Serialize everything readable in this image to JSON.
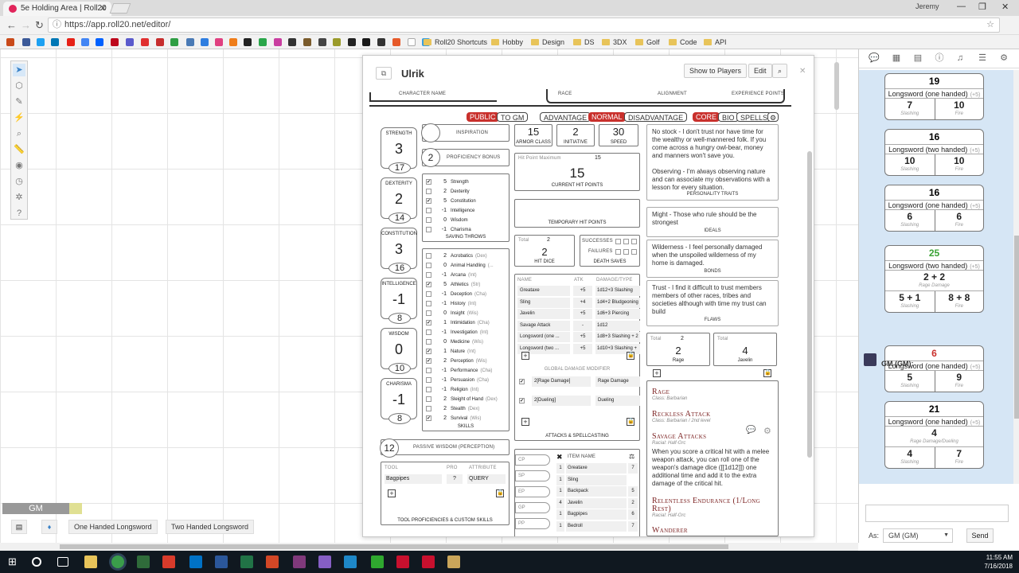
{
  "browser": {
    "tab_title": "5e Holding Area | Roll20",
    "user": "Jeremy",
    "url": "https://app.roll20.net/editor/",
    "bookmark_folders": [
      "Roll20 Shortcuts",
      "Hobby",
      "Design",
      "DS",
      "3DX",
      "Golf",
      "Code",
      "API"
    ]
  },
  "editor": {
    "player_tag": "GM",
    "macros": [
      "One Handed Longsword",
      "Two Handed Longsword"
    ]
  },
  "sheet": {
    "name": "Ulrik",
    "buttons": {
      "show": "Show to Players",
      "edit": "Edit"
    },
    "banner": {
      "character_name": "Character Name",
      "race": "Race",
      "alignment": "Alignment",
      "xp": "Experience Points"
    },
    "toggles": [
      "PUBLIC",
      "TO GM",
      "ADVANTAGE",
      "NORMAL",
      "DISADVANTAGE",
      "CORE",
      "BIO",
      "SPELLS"
    ],
    "abilities": [
      {
        "label": "Strength",
        "mod": "3",
        "score": "17"
      },
      {
        "label": "Dexterity",
        "mod": "2",
        "score": "14"
      },
      {
        "label": "Constitution",
        "mod": "3",
        "score": "16"
      },
      {
        "label": "Intelligence",
        "mod": "-1",
        "score": "8"
      },
      {
        "label": "Wisdom",
        "mod": "0",
        "score": "10"
      },
      {
        "label": "Charisma",
        "mod": "-1",
        "score": "8"
      }
    ],
    "inspiration_label": "Inspiration",
    "proficiency": {
      "value": "2",
      "label": "Proficiency Bonus"
    },
    "saves_title": "Saving Throws",
    "saves": [
      {
        "v": "5",
        "n": "Strength",
        "c": "✔"
      },
      {
        "v": "2",
        "n": "Dexterity",
        "c": ""
      },
      {
        "v": "5",
        "n": "Constitution",
        "c": "✔"
      },
      {
        "v": "-1",
        "n": "Intelligence",
        "c": ""
      },
      {
        "v": "0",
        "n": "Wisdom",
        "c": ""
      },
      {
        "v": "-1",
        "n": "Charisma",
        "c": ""
      }
    ],
    "skills_title": "Skills",
    "skills": [
      {
        "v": "2",
        "n": "Acrobatics",
        "a": "(Dex)",
        "c": ""
      },
      {
        "v": "0",
        "n": "Animal Handling",
        "a": "(...",
        "c": ""
      },
      {
        "v": "-1",
        "n": "Arcana",
        "a": "(Int)",
        "c": ""
      },
      {
        "v": "5",
        "n": "Athletics",
        "a": "(Str)",
        "c": "✔"
      },
      {
        "v": "-1",
        "n": "Deception",
        "a": "(Cha)",
        "c": ""
      },
      {
        "v": "-1",
        "n": "History",
        "a": "(Int)",
        "c": ""
      },
      {
        "v": "0",
        "n": "Insight",
        "a": "(Wis)",
        "c": ""
      },
      {
        "v": "1",
        "n": "Intimidation",
        "a": "(Cha)",
        "c": "✔"
      },
      {
        "v": "-1",
        "n": "Investigation",
        "a": "(Int)",
        "c": ""
      },
      {
        "v": "0",
        "n": "Medicine",
        "a": "(Wis)",
        "c": ""
      },
      {
        "v": "1",
        "n": "Nature",
        "a": "(Int)",
        "c": "✔"
      },
      {
        "v": "2",
        "n": "Perception",
        "a": "(Wis)",
        "c": "✔"
      },
      {
        "v": "-1",
        "n": "Performance",
        "a": "(Cha)",
        "c": ""
      },
      {
        "v": "-1",
        "n": "Persuasion",
        "a": "(Cha)",
        "c": ""
      },
      {
        "v": "-1",
        "n": "Religion",
        "a": "(Int)",
        "c": ""
      },
      {
        "v": "2",
        "n": "Sleight of Hand",
        "a": "(Dex)",
        "c": ""
      },
      {
        "v": "2",
        "n": "Stealth",
        "a": "(Dex)",
        "c": ""
      },
      {
        "v": "2",
        "n": "Survival",
        "a": "(Wis)",
        "c": "✔"
      }
    ],
    "passive": {
      "value": "12",
      "label": "Passive Wisdom (Perception)"
    },
    "tools": {
      "h_tool": "Tool",
      "h_pro": "Pro",
      "h_attr": "Attribute",
      "tool": "Bagpipes",
      "pro": "?",
      "attr": "QUERY",
      "title": "Tool Proficiencies & Custom Skills"
    },
    "ac": {
      "value": "15",
      "label": "Armor Class"
    },
    "initiative": {
      "value": "2",
      "label": "Initiative"
    },
    "speed": {
      "value": "30",
      "label": "Speed"
    },
    "hp": {
      "max_label": "Hit Point Maximum",
      "max": "15",
      "current": "15",
      "label": "Current Hit Points"
    },
    "temp_hp_label": "Temporary Hit Points",
    "hit_dice": {
      "total_label": "Total",
      "total": "2",
      "value": "2",
      "label": "Hit Dice"
    },
    "death_saves": {
      "successes": "Successes",
      "failures": "Failures",
      "label": "Death Saves"
    },
    "attacks": {
      "headers": [
        "Name",
        "Atk",
        "Damage/Type"
      ],
      "rows": [
        {
          "n": "Greataxe",
          "a": "+5",
          "d": "1d12+3 Slashing"
        },
        {
          "n": "Sling",
          "a": "+4",
          "d": "1d4+2 Bludgeoning"
        },
        {
          "n": "Javelin",
          "a": "+5",
          "d": "1d6+3 Piercing"
        },
        {
          "n": "Savage Attack",
          "a": "-",
          "d": "1d12"
        },
        {
          "n": "Longsword (one ...",
          "a": "+5",
          "d": "1d8+3 Slashing + 2"
        },
        {
          "n": "Longsword (two ...",
          "a": "+5",
          "d": "1d10+3 Slashing +"
        }
      ],
      "global_label": "Global Damage Modifier",
      "global": [
        {
          "n": "2[Rage Damage]",
          "t": "Rage Damage"
        },
        {
          "n": "2[Dueling]",
          "t": "Dueling"
        }
      ],
      "title": "Attacks & Spellcasting"
    },
    "currency": [
      "CP",
      "SP",
      "EP",
      "GP",
      "PP"
    ],
    "equipment": {
      "header": "Item Name",
      "rows": [
        {
          "q": "1",
          "n": "Greataxe",
          "w": "7"
        },
        {
          "q": "1",
          "n": "Sling",
          "w": ""
        },
        {
          "q": "1",
          "n": "Backpack",
          "w": "5"
        },
        {
          "q": "4",
          "n": "Javelin",
          "w": "2"
        },
        {
          "q": "1",
          "n": "Bagpipes",
          "w": "6"
        },
        {
          "q": "1",
          "n": "Bedroll",
          "w": "7"
        }
      ]
    },
    "traits": [
      {
        "text": "No stock - I don't trust nor have time for the wealthy or well-mannered folk. If you come across a hungry owl-bear, money and manners won't save you.\n\nObserving - I'm always observing nature and can associate my observations with a lesson for every situation.",
        "title": "Personality Traits"
      },
      {
        "text": "Might - Those who rule should be the strongest",
        "title": "Ideals"
      },
      {
        "text": "Wilderness - I feel personally damaged when the unspoiled wilderness of my home is damaged.",
        "title": "Bonds"
      },
      {
        "text": "Trust - I find it difficult to trust members members of other races, tribes and societies although with time my trust can build",
        "title": "Flaws"
      }
    ],
    "resources": [
      {
        "total_label": "Total",
        "total": "2",
        "value": "2",
        "label": "Rage"
      },
      {
        "total_label": "Total",
        "total": "",
        "value": "4",
        "label": "Javelin"
      }
    ],
    "features": [
      {
        "n": "Rage",
        "s": "Class: Barbarian"
      },
      {
        "n": "Reckless Attack",
        "s": "Class: Barbarian / 2nd level"
      },
      {
        "n": "Savage Attacks",
        "s": "Racial: Half-Orc",
        "d": "When you score a critical hit with a melee weapon attack, you can roll one of the weapon's damage dice ([[1d12]]) one additional time and add it to the extra damage of the critical hit."
      },
      {
        "n": "Relentless Endurance (1/Long Rest)",
        "s": "Racial: Half-Orc"
      },
      {
        "n": "Wanderer",
        "s": ""
      }
    ]
  },
  "chat": {
    "cards": [
      {
        "total": "19",
        "weapon": "Longsword (one handed)",
        "bonus": "(+5)",
        "left": "7",
        "left_label": "Slashing",
        "right": "10",
        "right_label": "Fire",
        "color": "#000000"
      },
      {
        "total": "16",
        "weapon": "Longsword (two handed)",
        "bonus": "(+5)",
        "left": "10",
        "left_label": "Slashing",
        "right": "10",
        "right_label": "Fire",
        "color": "#000000"
      },
      {
        "total": "16",
        "weapon": "Longsword (one handed)",
        "bonus": "(+5)",
        "left": "6",
        "left_label": "Slashing",
        "right": "6",
        "right_label": "Fire",
        "color": "#000000"
      },
      {
        "total": "25",
        "weapon": "Longsword (two handed)",
        "bonus": "(+5)",
        "full": "2 + 2",
        "full_label": "Rage Damage",
        "left": "5 + 1",
        "left_label": "Slashing",
        "right": "8 + 8",
        "right_label": "Fire",
        "color": "#3aa335"
      }
    ],
    "gm_header": "GM (GM):",
    "gm_cards": [
      {
        "total": "6",
        "weapon": "Longsword (one handed)",
        "bonus": "(+5)",
        "left": "5",
        "left_label": "Slashing",
        "right": "9",
        "right_label": "Fire",
        "color": "#c9302c"
      },
      {
        "total": "21",
        "weapon": "Longsword (one handed)",
        "bonus": "(+5)",
        "full": "4",
        "full_label": "Rage Damage/Dueling",
        "left": "4",
        "left_label": "Slashing",
        "right": "7",
        "right_label": "Fire",
        "color": "#000000"
      }
    ],
    "as_label": "As:",
    "as_value": "GM (GM)",
    "send_label": "Send"
  },
  "taskbar": {
    "time": "11:55 AM",
    "date": "7/16/2018"
  }
}
